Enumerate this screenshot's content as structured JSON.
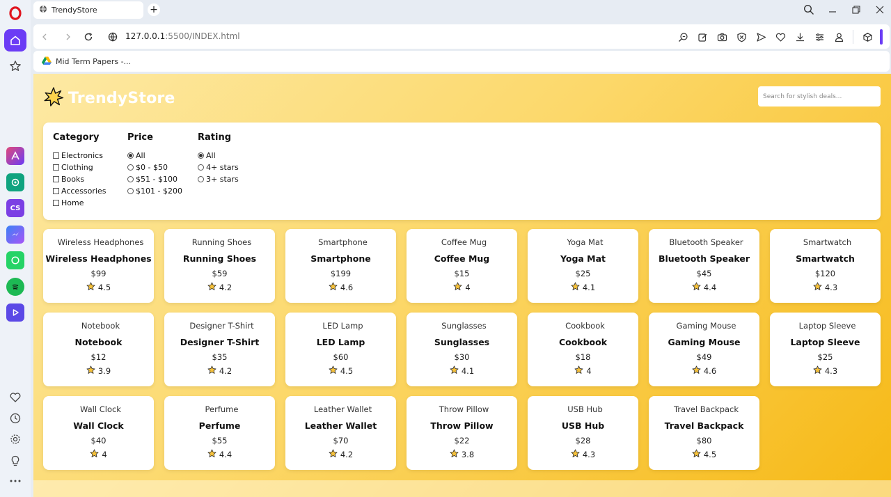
{
  "browser": {
    "tab_title": "TrendyStore",
    "new_tab_label": "+",
    "url_host": "127.0.0.1",
    "url_rest": ":5500/INDEX.html",
    "bookmark_label": "Mid Term Papers -..."
  },
  "header": {
    "logo_text": "TrendyStore",
    "search_placeholder": "Search for stylish deals..."
  },
  "filters": {
    "category": {
      "title": "Category",
      "options": [
        "Electronics",
        "Clothing",
        "Books",
        "Accessories",
        "Home"
      ]
    },
    "price": {
      "title": "Price",
      "options": [
        "All",
        "$0 - $50",
        "$51 - $100",
        "$101 - $200"
      ],
      "selected": 0
    },
    "rating": {
      "title": "Rating",
      "options": [
        "All",
        "4+ stars",
        "3+ stars"
      ],
      "selected": 0
    }
  },
  "products": [
    {
      "name": "Wireless Headphones",
      "price": "$99",
      "rating": "4.5"
    },
    {
      "name": "Running Shoes",
      "price": "$59",
      "rating": "4.2"
    },
    {
      "name": "Smartphone",
      "price": "$199",
      "rating": "4.6"
    },
    {
      "name": "Coffee Mug",
      "price": "$15",
      "rating": "4"
    },
    {
      "name": "Yoga Mat",
      "price": "$25",
      "rating": "4.1"
    },
    {
      "name": "Bluetooth Speaker",
      "price": "$45",
      "rating": "4.4"
    },
    {
      "name": "Smartwatch",
      "price": "$120",
      "rating": "4.3"
    },
    {
      "name": "Notebook",
      "price": "$12",
      "rating": "3.9"
    },
    {
      "name": "Designer T-Shirt",
      "price": "$35",
      "rating": "4.2"
    },
    {
      "name": "LED Lamp",
      "price": "$60",
      "rating": "4.5"
    },
    {
      "name": "Sunglasses",
      "price": "$30",
      "rating": "4.1"
    },
    {
      "name": "Cookbook",
      "price": "$18",
      "rating": "4"
    },
    {
      "name": "Gaming Mouse",
      "price": "$49",
      "rating": "4.6"
    },
    {
      "name": "Laptop Sleeve",
      "price": "$25",
      "rating": "4.3"
    },
    {
      "name": "Wall Clock",
      "price": "$40",
      "rating": "4"
    },
    {
      "name": "Perfume",
      "price": "$55",
      "rating": "4.4"
    },
    {
      "name": "Leather Wallet",
      "price": "$70",
      "rating": "4.2"
    },
    {
      "name": "Throw Pillow",
      "price": "$22",
      "rating": "3.8"
    },
    {
      "name": "USB Hub",
      "price": "$28",
      "rating": "4.3"
    },
    {
      "name": "Travel Backpack",
      "price": "$80",
      "rating": "4.5"
    }
  ],
  "colors": {
    "opera_accent": "#6b3cf5",
    "page_gradient_start": "#fde9a4",
    "page_gradient_end": "#f6b814",
    "star_fill": "#f7c23a"
  }
}
